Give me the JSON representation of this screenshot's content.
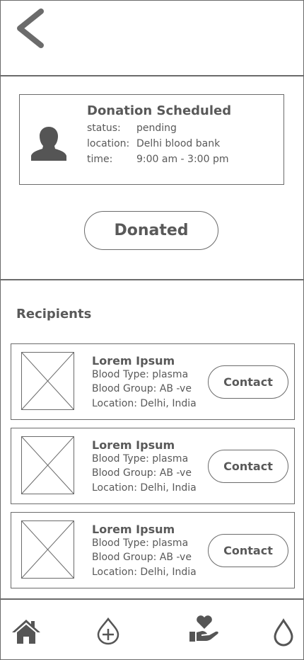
{
  "donation": {
    "title": "Donation Scheduled",
    "status_label": "status:",
    "status_value": "pending",
    "location_label": "location:",
    "location_value": "Delhi blood bank",
    "time_label": "time:",
    "time_value": "9:00 am - 3:00 pm"
  },
  "donated_button": "Donated",
  "recipients": {
    "heading": "Recipients",
    "items": [
      {
        "name": "Lorem Ipsum",
        "blood_type": "Blood Type: plasma",
        "blood_group": "Blood Group: AB -ve",
        "location": "Location: Delhi, India",
        "contact_label": "Contact"
      },
      {
        "name": "Lorem Ipsum",
        "blood_type": "Blood Type: plasma",
        "blood_group": "Blood Group: AB -ve",
        "location": "Location: Delhi, India",
        "contact_label": "Contact"
      },
      {
        "name": "Lorem Ipsum",
        "blood_type": "Blood Type: plasma",
        "blood_group": "Blood Group: AB -ve",
        "location": "Location: Delhi, India",
        "contact_label": "Contact"
      }
    ]
  },
  "nav": {
    "items": [
      "home-icon",
      "donate-drop-plus-icon",
      "hand-heart-icon",
      "blood-drop-icon"
    ]
  },
  "colors": {
    "stroke": "#6b6b6b",
    "text": "#595959",
    "icon": "#555555"
  }
}
